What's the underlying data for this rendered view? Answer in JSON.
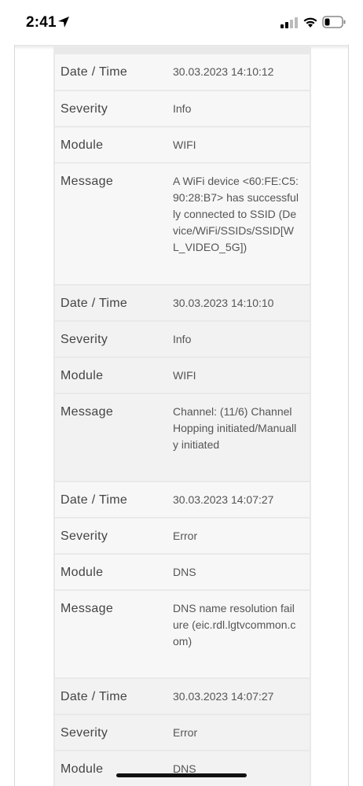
{
  "status_bar": {
    "time": "2:41"
  },
  "log_entries": [
    {
      "date_time_label": "Date / Time",
      "date_time": "30.03.2023 14:10:12",
      "severity_label": "Severity",
      "severity": "Info",
      "module_label": "Module",
      "module": "WIFI",
      "message_label": "Message",
      "message": "A WiFi device <60:FE:C5:90:28:B7> has successfully connected to SSID (Device/WiFi/SSIDs/SSID[WL_VIDEO_5G])"
    },
    {
      "date_time_label": "Date / Time",
      "date_time": "30.03.2023 14:10:10",
      "severity_label": "Severity",
      "severity": "Info",
      "module_label": "Module",
      "module": "WIFI",
      "message_label": "Message",
      "message": "Channel: (11/6) Channel Hopping initiated/Manually initiated"
    },
    {
      "date_time_label": "Date / Time",
      "date_time": "30.03.2023 14:07:27",
      "severity_label": "Severity",
      "severity": "Error",
      "module_label": "Module",
      "module": "DNS",
      "message_label": "Message",
      "message": "DNS name resolution failure (eic.rdl.lgtvcommon.com)"
    },
    {
      "date_time_label": "Date / Time",
      "date_time": "30.03.2023 14:07:27",
      "severity_label": "Severity",
      "severity": "Error",
      "module_label": "Module",
      "module": "DNS"
    }
  ]
}
